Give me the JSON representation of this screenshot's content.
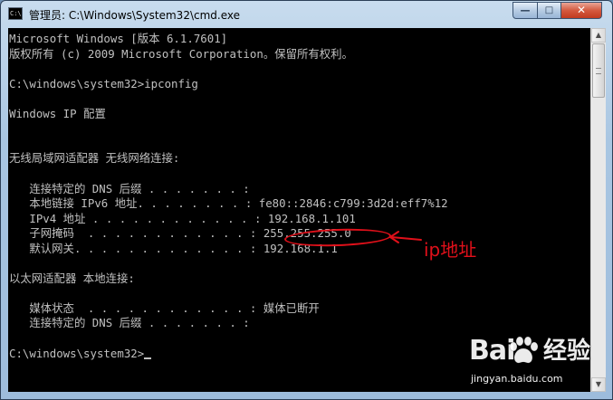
{
  "window": {
    "title": "管理员: C:\\Windows\\System32\\cmd.exe",
    "icon_label": "C:\\",
    "controls": {
      "minimize": "—",
      "maximize": "□",
      "close": "✕"
    }
  },
  "console": {
    "lines": [
      "Microsoft Windows [版本 6.1.7601]",
      "版权所有 (c) 2009 Microsoft Corporation。保留所有权利。",
      "",
      "C:\\windows\\system32>ipconfig",
      "",
      "Windows IP 配置",
      "",
      "",
      "无线局域网适配器 无线网络连接:",
      "",
      "   连接特定的 DNS 后缀 . . . . . . . :",
      "   本地链接 IPv6 地址. . . . . . . . : fe80::2846:c799:3d2d:eff7%12",
      "   IPv4 地址 . . . . . . . . . . . . : 192.168.1.101",
      "   子网掩码  . . . . . . . . . . . . : 255.255.255.0",
      "   默认网关. . . . . . . . . . . . . : 192.168.1.1",
      "",
      "以太网适配器 本地连接:",
      "",
      "   媒体状态  . . . . . . . . . . . . : 媒体已断开",
      "   连接特定的 DNS 后缀 . . . . . . . :",
      "",
      "C:\\windows\\system32>"
    ]
  },
  "annotation": {
    "label": "ip地址",
    "color": "#e0101a"
  },
  "watermark": {
    "brand": "Bai",
    "brand_suffix": "经验",
    "url": "jingyan.baidu.com"
  },
  "colors": {
    "console_bg": "#000000",
    "console_text": "#c0c0c0",
    "close_button": "#c13a1f",
    "annotation": "#e0101a"
  }
}
